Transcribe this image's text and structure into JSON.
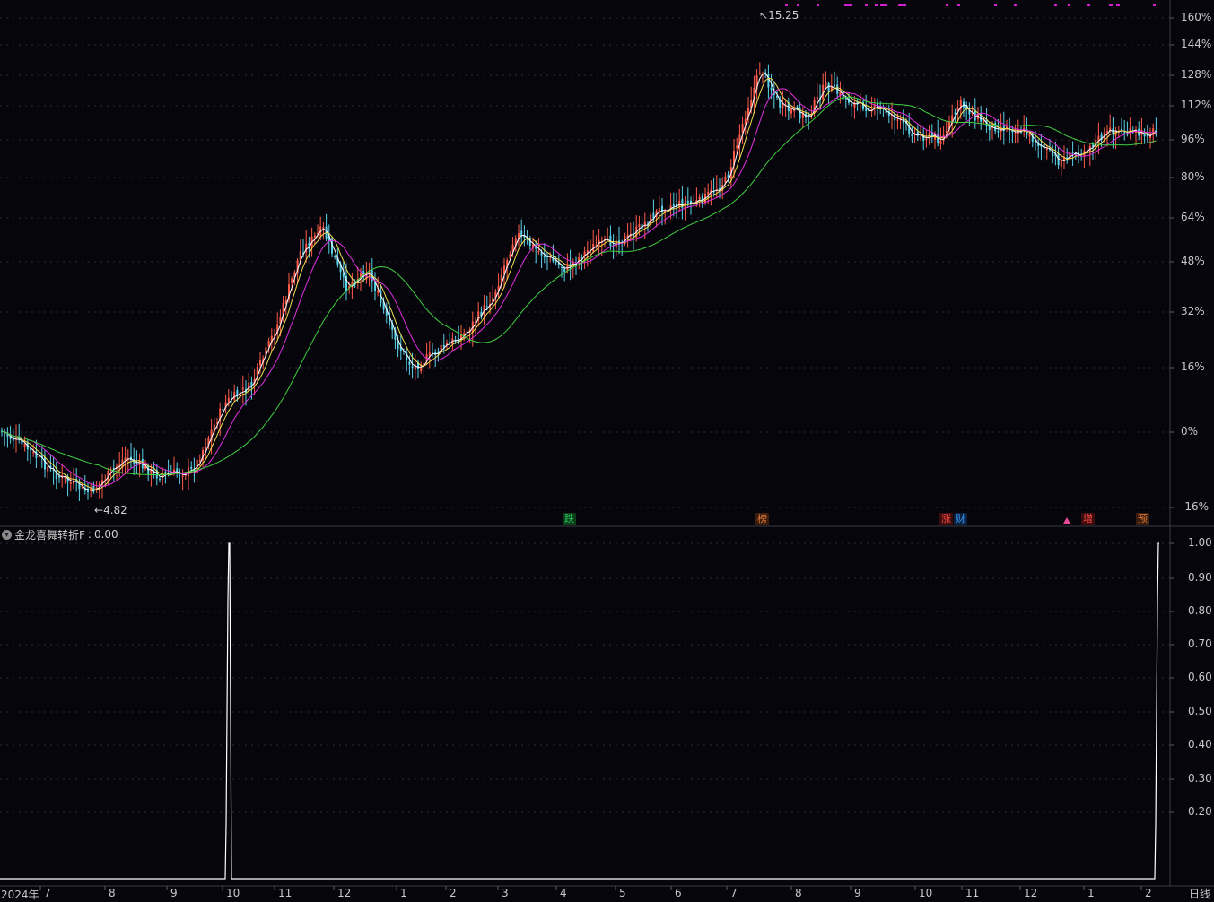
{
  "price_axis": [
    "160%",
    "144%",
    "128%",
    "112%",
    "96%",
    "80%",
    "64%",
    "48%",
    "32%",
    "16%",
    "0%",
    "-16%"
  ],
  "indicator_axis": [
    "1.00",
    "0.90",
    "0.80",
    "0.70",
    "0.60",
    "0.50",
    "0.40",
    "0.30",
    "0.20"
  ],
  "high_marker": "15.25",
  "low_marker": "4.82",
  "indicator": {
    "name": "金龙喜舞转折F",
    "value": "0.00"
  },
  "badges": [
    {
      "text": "跌",
      "color": "#26c25a",
      "bg": "#0d3d1a"
    },
    {
      "text": "榜",
      "color": "#e87d3e",
      "bg": "#3a1d0c"
    },
    {
      "text": "涨",
      "color": "#ff4a4a",
      "bg": "#3d0d0d"
    },
    {
      "text": "财",
      "color": "#39a0ff",
      "bg": "#0b2140"
    },
    {
      "text": "增",
      "color": "#ff4a4a",
      "bg": "#3d0d0d"
    },
    {
      "text": "预",
      "color": "#e87d3e",
      "bg": "#3a1d0c"
    }
  ],
  "months": [
    "2024年",
    "7",
    "8",
    "9",
    "10",
    "11",
    "12",
    "1",
    "2",
    "3",
    "4",
    "5",
    "6",
    "7",
    "8",
    "9",
    "10",
    "11",
    "12",
    "1",
    "2"
  ],
  "period": "日线",
  "colors": {
    "up": "#ff5a4a",
    "down": "#5ad2e8",
    "ma5": "#ffffff",
    "ma10": "#f2e050",
    "ma20": "#e030e0",
    "ma60": "#40d040"
  }
}
